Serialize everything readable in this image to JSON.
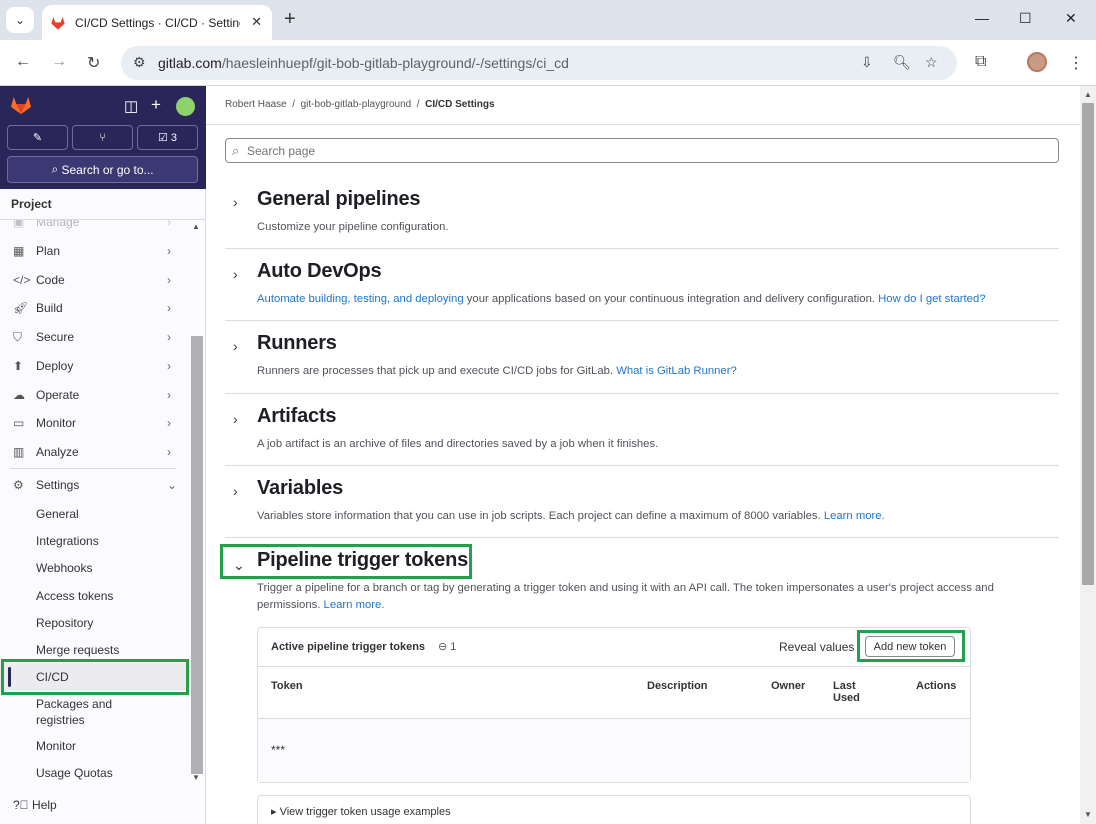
{
  "browser": {
    "tab_title": "CI/CD Settings · CI/CD · Settings · git-bob-gitlab-playground",
    "url_host": "gitlab.com",
    "url_path": "/haesleinhuepf/git-bob-gitlab-playground/-/settings/ci_cd"
  },
  "sidebar": {
    "todo_count": "3",
    "search_label": "Search or go to...",
    "project_label": "Project",
    "partial_item": "Manage",
    "items": [
      {
        "label": "Plan",
        "icon": "plan-icon"
      },
      {
        "label": "Code",
        "icon": "code-icon"
      },
      {
        "label": "Build",
        "icon": "rocket-icon"
      },
      {
        "label": "Secure",
        "icon": "shield-icon"
      },
      {
        "label": "Deploy",
        "icon": "deploy-icon"
      },
      {
        "label": "Operate",
        "icon": "cloud-icon"
      },
      {
        "label": "Monitor",
        "icon": "monitor-icon"
      },
      {
        "label": "Analyze",
        "icon": "chart-icon"
      }
    ],
    "settings_label": "Settings",
    "sub_items": [
      "General",
      "Integrations",
      "Webhooks",
      "Access tokens",
      "Repository",
      "Merge requests",
      "CI/CD",
      "Packages and registries",
      "Monitor",
      "Usage Quotas"
    ],
    "help_label": "Help"
  },
  "breadcrumb": {
    "owner": "Robert Haase",
    "project": "git-bob-gitlab-playground",
    "current": "CI/CD Settings"
  },
  "search_placeholder": "Search page",
  "sections": {
    "general": {
      "title": "General pipelines",
      "desc": "Customize your pipeline configuration."
    },
    "autodevops": {
      "title": "Auto DevOps",
      "link1": "Automate building, testing, and deploying",
      "desc": " your applications based on your continuous integration and delivery configuration. ",
      "link2": "How do I get started?"
    },
    "runners": {
      "title": "Runners",
      "desc": "Runners are processes that pick up and execute CI/CD jobs for GitLab. ",
      "link": "What is GitLab Runner?"
    },
    "artifacts": {
      "title": "Artifacts",
      "desc": "A job artifact is an archive of files and directories saved by a job when it finishes."
    },
    "variables": {
      "title": "Variables",
      "desc": "Variables store information that you can use in job scripts. Each project can define a maximum of 8000 variables. ",
      "link": "Learn more."
    },
    "triggers": {
      "title": "Pipeline trigger tokens",
      "desc": "Trigger a pipeline for a branch or tag by generating a trigger token and using it with an API call. The token impersonates a user's project access and permissions. ",
      "link": "Learn more."
    }
  },
  "tokens_card": {
    "title": "Active pipeline trigger tokens",
    "count": "1",
    "reveal_label": "Reveal values",
    "add_label": "Add new token",
    "columns": {
      "token": "Token",
      "description": "Description",
      "owner": "Owner",
      "last_used": "Last Used",
      "actions": "Actions"
    },
    "row_token": "***"
  },
  "examples_label": "View trigger token usage examples",
  "highlight_color": "#22a04b"
}
